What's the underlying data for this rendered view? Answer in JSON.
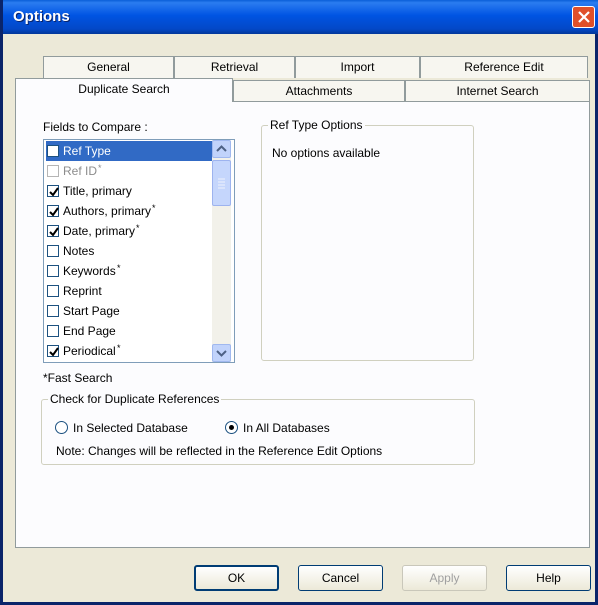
{
  "window": {
    "title": "Options"
  },
  "tabs": {
    "row_back": [
      "General",
      "Retrieval",
      "Import",
      "Reference Edit"
    ],
    "row_front": [
      "Duplicate Search",
      "Attachments",
      "Internet Search"
    ],
    "active": "Duplicate Search"
  },
  "fields": {
    "label": "Fields to Compare :",
    "items": [
      {
        "label": "Ref Type",
        "star": "",
        "checked": false,
        "selected": true,
        "disabled": false
      },
      {
        "label": "Ref ID",
        "star": "*",
        "checked": false,
        "selected": false,
        "disabled": true
      },
      {
        "label": "Title, primary",
        "star": "",
        "checked": true,
        "selected": false,
        "disabled": false
      },
      {
        "label": "Authors, primary",
        "star": "*",
        "checked": true,
        "selected": false,
        "disabled": false
      },
      {
        "label": "Date, primary",
        "star": "*",
        "checked": true,
        "selected": false,
        "disabled": false
      },
      {
        "label": "Notes",
        "star": "",
        "checked": false,
        "selected": false,
        "disabled": false
      },
      {
        "label": "Keywords",
        "star": "*",
        "checked": false,
        "selected": false,
        "disabled": false
      },
      {
        "label": "Reprint",
        "star": "",
        "checked": false,
        "selected": false,
        "disabled": false
      },
      {
        "label": "Start Page",
        "star": "",
        "checked": false,
        "selected": false,
        "disabled": false
      },
      {
        "label": "End Page",
        "star": "",
        "checked": false,
        "selected": false,
        "disabled": false
      },
      {
        "label": "Periodical",
        "star": "*",
        "checked": true,
        "selected": false,
        "disabled": false
      }
    ],
    "fast_search_note": "*Fast Search"
  },
  "ref_type_options": {
    "title": "Ref Type Options",
    "message": "No options available"
  },
  "duplicate_refs": {
    "title": "Check for Duplicate References",
    "options": [
      {
        "label": "In Selected Database",
        "selected": false
      },
      {
        "label": "In All Databases",
        "selected": true
      }
    ],
    "note": "Note: Changes will be reflected in the Reference Edit Options"
  },
  "buttons": {
    "ok": "OK",
    "cancel": "Cancel",
    "apply": "Apply",
    "help": "Help"
  },
  "colors": {
    "titlebar": "#0054e3",
    "selection": "#316ac5",
    "close": "#e0502a"
  }
}
